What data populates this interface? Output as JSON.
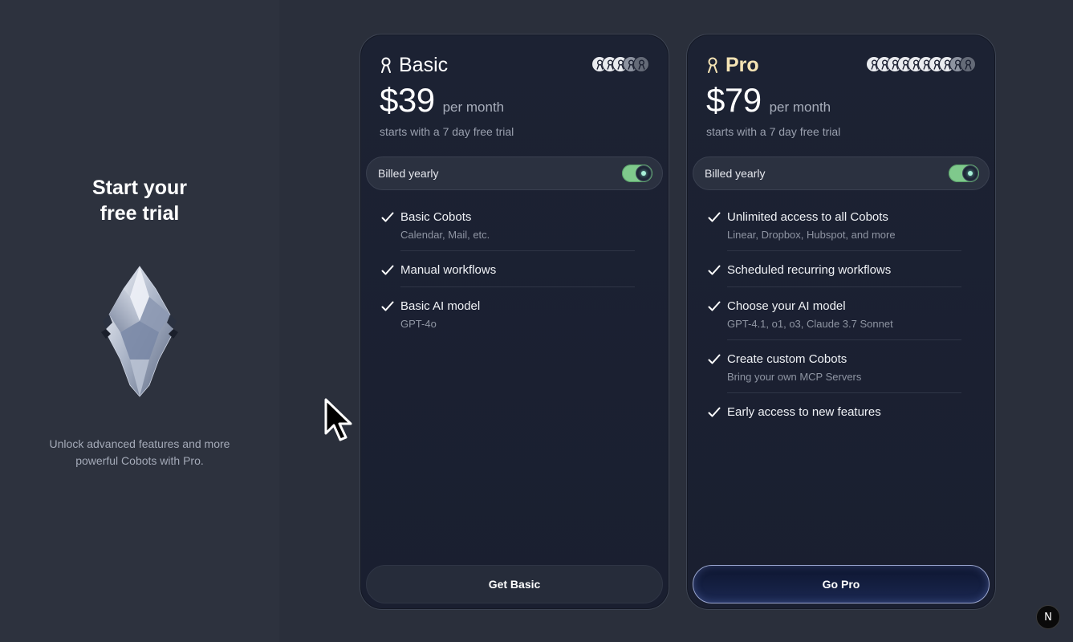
{
  "hero": {
    "title_line1": "Start your",
    "title_line2": "free trial",
    "subtitle": "Unlock advanced features and more powerful Cobots with Pro."
  },
  "plans": [
    {
      "name": "Basic",
      "price": "$39",
      "period": "per month",
      "trial": "starts with a 7 day free trial",
      "billing_label": "Billed yearly",
      "billing_on": true,
      "features": [
        {
          "title": "Basic Cobots",
          "sub": "Calendar, Mail, etc."
        },
        {
          "title": "Manual workflows",
          "sub": ""
        },
        {
          "title": "Basic AI model",
          "sub": "GPT-4o"
        }
      ],
      "cta": "Get Basic"
    },
    {
      "name": "Pro",
      "price": "$79",
      "period": "per month",
      "trial": "starts with a 7 day free trial",
      "billing_label": "Billed yearly",
      "billing_on": true,
      "features": [
        {
          "title": "Unlimited access to all Cobots",
          "sub": "Linear, Dropbox, Hubspot, and more"
        },
        {
          "title": "Scheduled recurring workflows",
          "sub": ""
        },
        {
          "title": "Choose your AI model",
          "sub": "GPT-4.1, o1, o3, Claude 3.7 Sonnet"
        },
        {
          "title": "Create custom Cobots",
          "sub": "Bring your own MCP Servers"
        },
        {
          "title": "Early access to new features",
          "sub": ""
        }
      ],
      "cta": "Go Pro"
    }
  ],
  "badge": {
    "label": "N"
  },
  "colors": {
    "accent_toggle": "#7fc98c",
    "pro_name": "#f4e3b4",
    "background": "#2b303c"
  }
}
